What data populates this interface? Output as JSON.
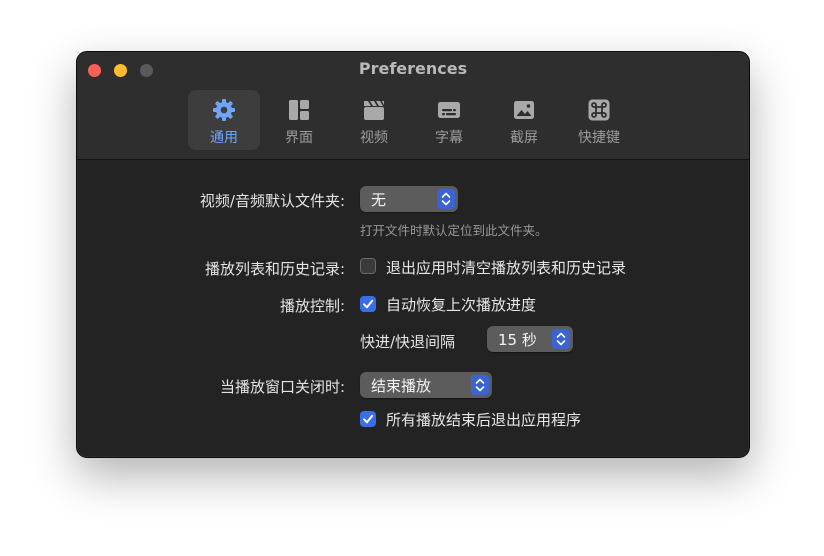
{
  "window": {
    "title": "Preferences"
  },
  "tabs": [
    {
      "label": "通用",
      "icon": "gear-icon",
      "active": true
    },
    {
      "label": "界面",
      "icon": "layout-icon",
      "active": false
    },
    {
      "label": "视频",
      "icon": "clapperboard-icon",
      "active": false
    },
    {
      "label": "字幕",
      "icon": "subtitles-icon",
      "active": false
    },
    {
      "label": "截屏",
      "icon": "picture-icon",
      "active": false
    },
    {
      "label": "快捷键",
      "icon": "command-key-icon",
      "active": false
    }
  ],
  "settings": {
    "default_folder": {
      "label": "视频/音频默认文件夹:",
      "value": "无",
      "hint": "打开文件时默认定位到此文件夹。"
    },
    "history": {
      "label": "播放列表和历史记录:",
      "checkbox_label": "退出应用时清空播放列表和历史记录",
      "checked": false
    },
    "playback": {
      "label": "播放控制:",
      "checkbox_label": "自动恢复上次播放进度",
      "checked": true,
      "seek_label": "快进/快退间隔",
      "seek_value": "15 秒"
    },
    "on_close": {
      "label": "当播放窗口关闭时:",
      "value": "结束播放",
      "checkbox_label": "所有播放结束后退出应用程序",
      "checked": true
    }
  },
  "colors": {
    "accent": "#3a6ee8",
    "active_tab_text": "#6ea5f7",
    "close": "#fe5f57",
    "minimize": "#febc2e"
  }
}
